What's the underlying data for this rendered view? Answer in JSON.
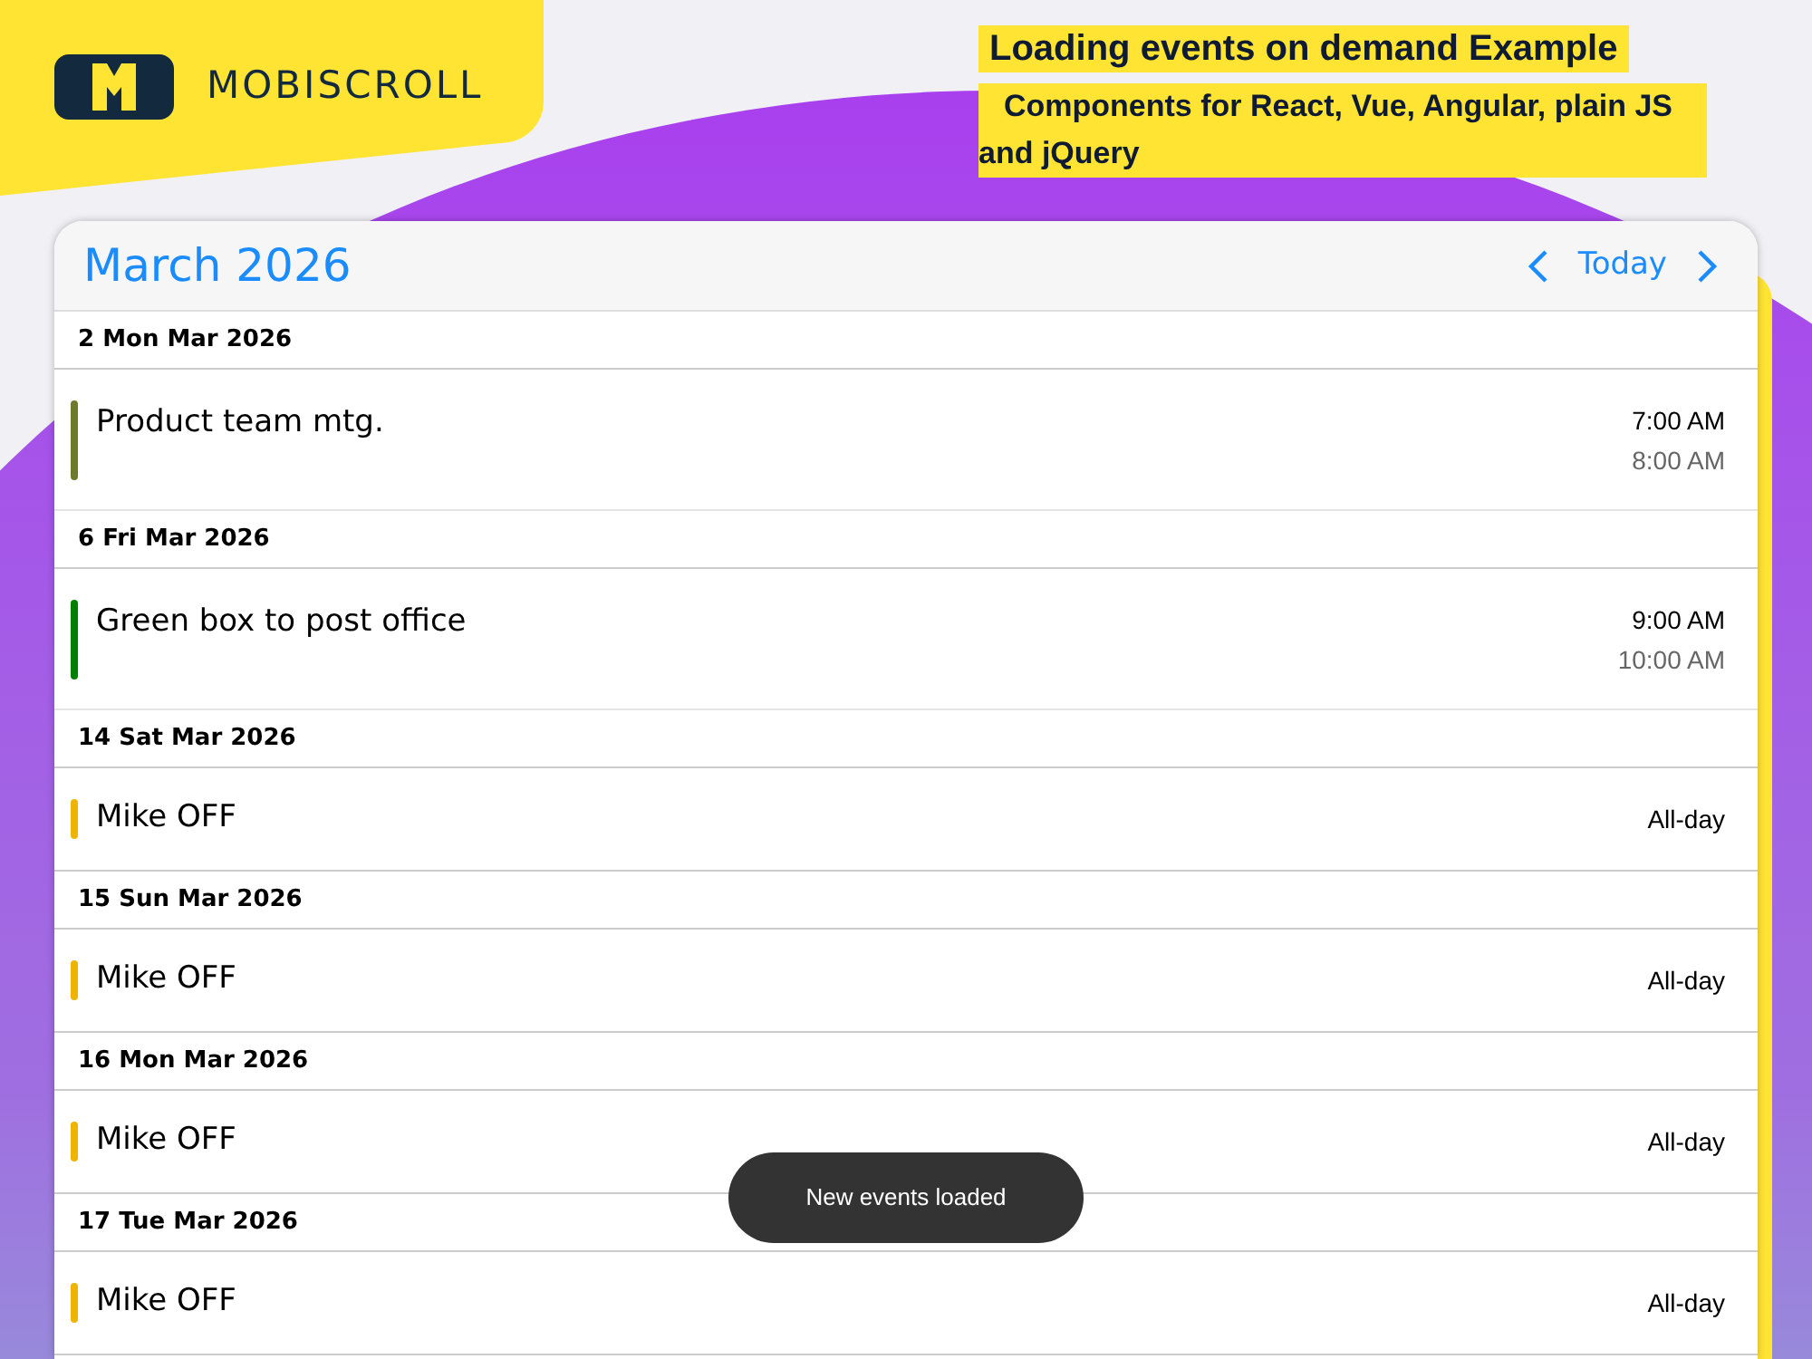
{
  "brand": {
    "name": "MOBISCROLL"
  },
  "heading": {
    "title": "Loading events on demand Example",
    "subtitle": "Components for React, Vue, Angular, plain JS and jQuery"
  },
  "calendar": {
    "month": "March 2026",
    "today_button": "Today",
    "days": [
      {
        "date": "2 Mon Mar 2026",
        "events": [
          {
            "kind": "timed",
            "title": "Product team mtg.",
            "color": "#6e7a2a",
            "start": "7:00 AM",
            "end": "8:00 AM"
          }
        ]
      },
      {
        "date": "6 Fri Mar 2026",
        "events": [
          {
            "kind": "timed",
            "title": "Green box to post office",
            "color": "#008000",
            "start": "9:00 AM",
            "end": "10:00 AM"
          }
        ]
      },
      {
        "date": "14 Sat Mar 2026",
        "events": [
          {
            "kind": "allday",
            "title": "Mike OFF",
            "color": "#f0b400",
            "label": "All-day"
          }
        ]
      },
      {
        "date": "15 Sun Mar 2026",
        "events": [
          {
            "kind": "allday",
            "title": "Mike OFF",
            "color": "#f0b400",
            "label": "All-day"
          }
        ]
      },
      {
        "date": "16 Mon Mar 2026",
        "events": [
          {
            "kind": "allday",
            "title": "Mike OFF",
            "color": "#f0b400",
            "label": "All-day"
          }
        ]
      },
      {
        "date": "17 Tue Mar 2026",
        "events": [
          {
            "kind": "allday",
            "title": "Mike OFF",
            "color": "#f0b400",
            "label": "All-day"
          }
        ]
      }
    ]
  },
  "toast": {
    "message": "New events loaded"
  }
}
